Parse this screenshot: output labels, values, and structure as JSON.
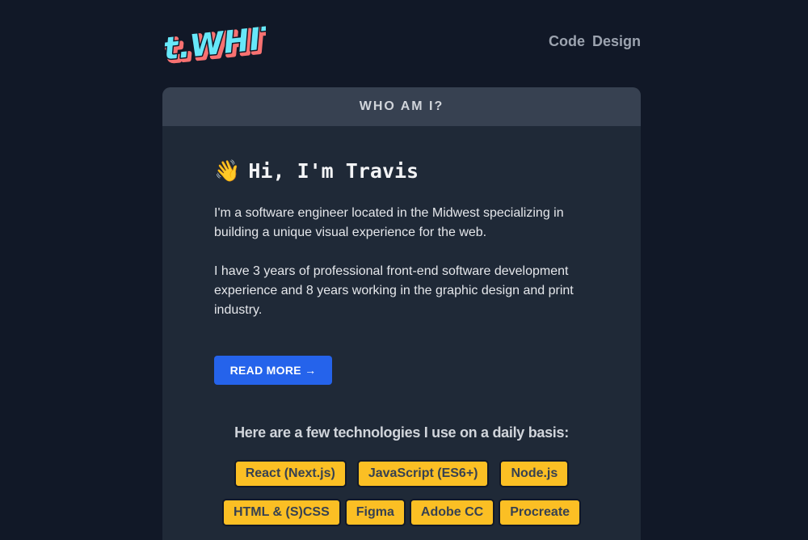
{
  "header": {
    "logo_text": "t.WHITE",
    "nav": [
      {
        "label": "Code"
      },
      {
        "label": "Design"
      }
    ]
  },
  "card": {
    "title": "WHO AM I?",
    "wave_emoji": "👋",
    "greeting": "Hi, I'm Travis",
    "paragraphs": [
      "I'm a software engineer located in the Midwest specializing in building a unique visual experience for the web.",
      "I have 3 years of professional front-end software development experience and 8 years working in the graphic design and print industry."
    ],
    "read_more_label": "READ MORE →",
    "tech_heading": "Here are a few technologies I use on a daily basis:",
    "tech_row1": [
      "React (Next.js)",
      "JavaScript (ES6+)",
      "Node.js"
    ],
    "tech_row2": [
      "HTML & (S)CSS",
      "Figma",
      "Adobe CC",
      "Procreate"
    ]
  },
  "colors": {
    "background": "#111827",
    "card": "#1f2937",
    "card_header": "#374151",
    "accent_blue": "#2563eb",
    "tag_yellow": "#fbbf24",
    "logo_cyan": "#67e8f9",
    "logo_red": "#f87171"
  }
}
